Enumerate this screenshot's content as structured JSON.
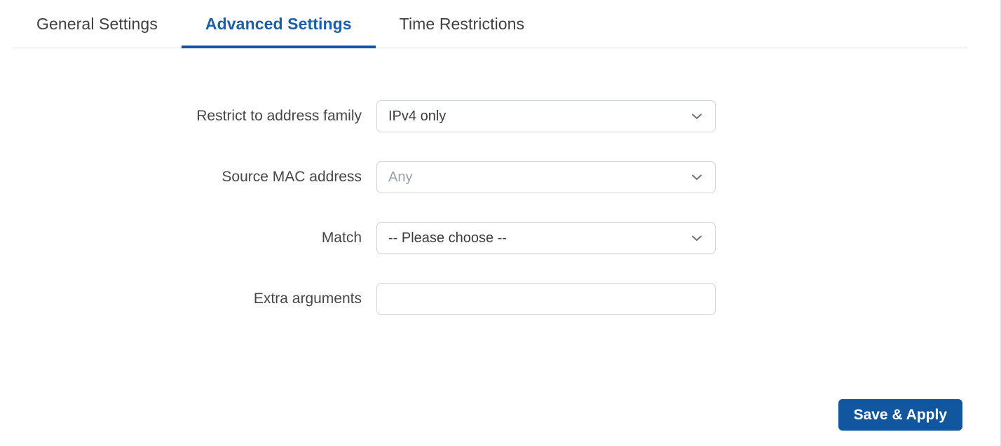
{
  "tabs": [
    {
      "label": "General Settings",
      "active": false
    },
    {
      "label": "Advanced Settings",
      "active": true
    },
    {
      "label": "Time Restrictions",
      "active": false
    }
  ],
  "form": {
    "rows": [
      {
        "label": "Restrict to address family",
        "control": "select",
        "value": "IPv4 only",
        "is_placeholder": false
      },
      {
        "label": "Source MAC address",
        "control": "select",
        "value": "Any",
        "is_placeholder": true
      },
      {
        "label": "Match",
        "control": "select",
        "value": "-- Please choose --",
        "is_placeholder": false
      },
      {
        "label": "Extra arguments",
        "control": "text",
        "value": "",
        "is_placeholder": false
      }
    ]
  },
  "footer": {
    "save_label": "Save & Apply"
  },
  "icons": {
    "chevron": "chevron-down-icon"
  },
  "colors": {
    "accent": "#11569f",
    "active_tab_text": "#1a5fa8",
    "label_text": "#464646",
    "placeholder_text": "#9aa3ab",
    "field_border": "#cfd4d8",
    "divider": "#e3e3e3",
    "page_background": "#ffffff"
  }
}
